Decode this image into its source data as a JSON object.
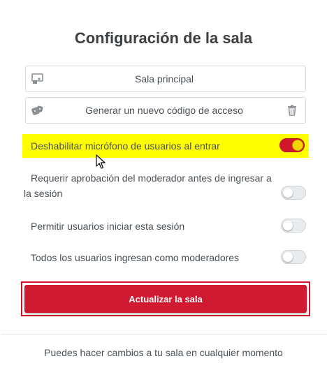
{
  "dialog": {
    "title": "Configuración de la sala"
  },
  "room_name": {
    "value": "Sala principal",
    "icon": "room-icon"
  },
  "access_code": {
    "label": "Generar un nuevo código de acceso",
    "icon": "dice-icon",
    "delete_icon": "trash-icon"
  },
  "options": [
    {
      "label": "Deshabilitar micrófono de usuarios al entrar",
      "enabled": true
    },
    {
      "label": "Requerir aprobación del moderador antes de ingresar a la sesión",
      "enabled": false
    },
    {
      "label": "Permitir usuarios iniciar esta sesión",
      "enabled": false
    },
    {
      "label": "Todos los usuarios ingresan como moderadores",
      "enabled": false
    }
  ],
  "update_button": {
    "label": "Actualizar la sala"
  },
  "footer": {
    "text": "Puedes hacer cambios a tu sala en cualquier momento"
  },
  "colors": {
    "accent": "#d01a32",
    "highlight": "#ffff00",
    "knob_on": "#f5d400"
  }
}
